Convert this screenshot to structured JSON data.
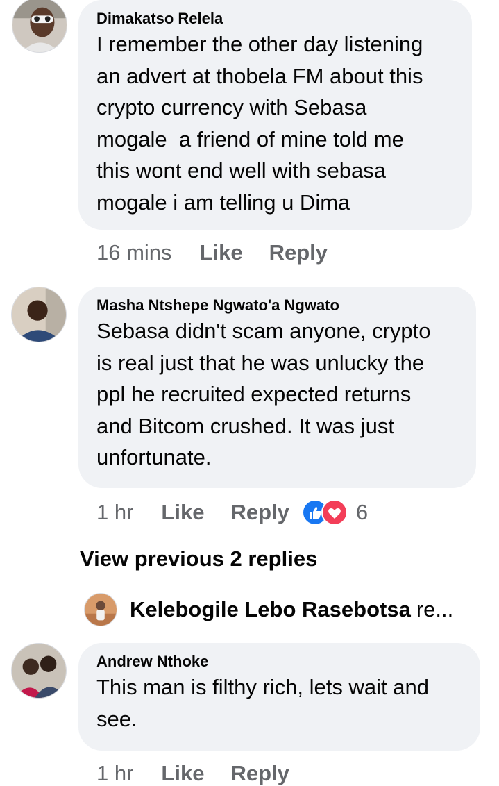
{
  "comments": [
    {
      "author": "Dimakatso Relela",
      "text": [
        "I remember the other day listening",
        "an advert at thobela FM about this",
        "crypto currency with Sebasa",
        "mogale  a friend of mine told me",
        "this wont end well with sebasa",
        "mogale i am telling u Dima"
      ],
      "time": "16 mins",
      "like": "Like",
      "reply": "Reply"
    },
    {
      "author": "Masha Ntshepe Ngwato'a Ngwato",
      "text": [
        "Sebasa didn't scam anyone, crypto",
        "is real just that he was unlucky the",
        "ppl he recruited expected returns",
        "and Bitcom crushed. It was just",
        "unfortunate."
      ],
      "time": "1 hr",
      "like": "Like",
      "reply": "Reply",
      "reactions": {
        "icons": [
          "like-reaction-icon",
          "love-reaction-icon"
        ],
        "count": "6"
      }
    },
    {
      "author": "Andrew Nthoke",
      "text": [
        "This man is filthy rich, lets wait and",
        "see."
      ],
      "time": "1 hr",
      "like": "Like",
      "reply": "Reply"
    }
  ],
  "view_previous": "View previous 2 replies",
  "reply_preview": {
    "name": "Kelebogile Lebo Rasebotsa",
    "truncated": "re..."
  },
  "colors": {
    "bubble": "#f0f2f5",
    "meta_text": "#65676b",
    "like_blue": "#1877f2",
    "love_red": "#f33e58"
  }
}
